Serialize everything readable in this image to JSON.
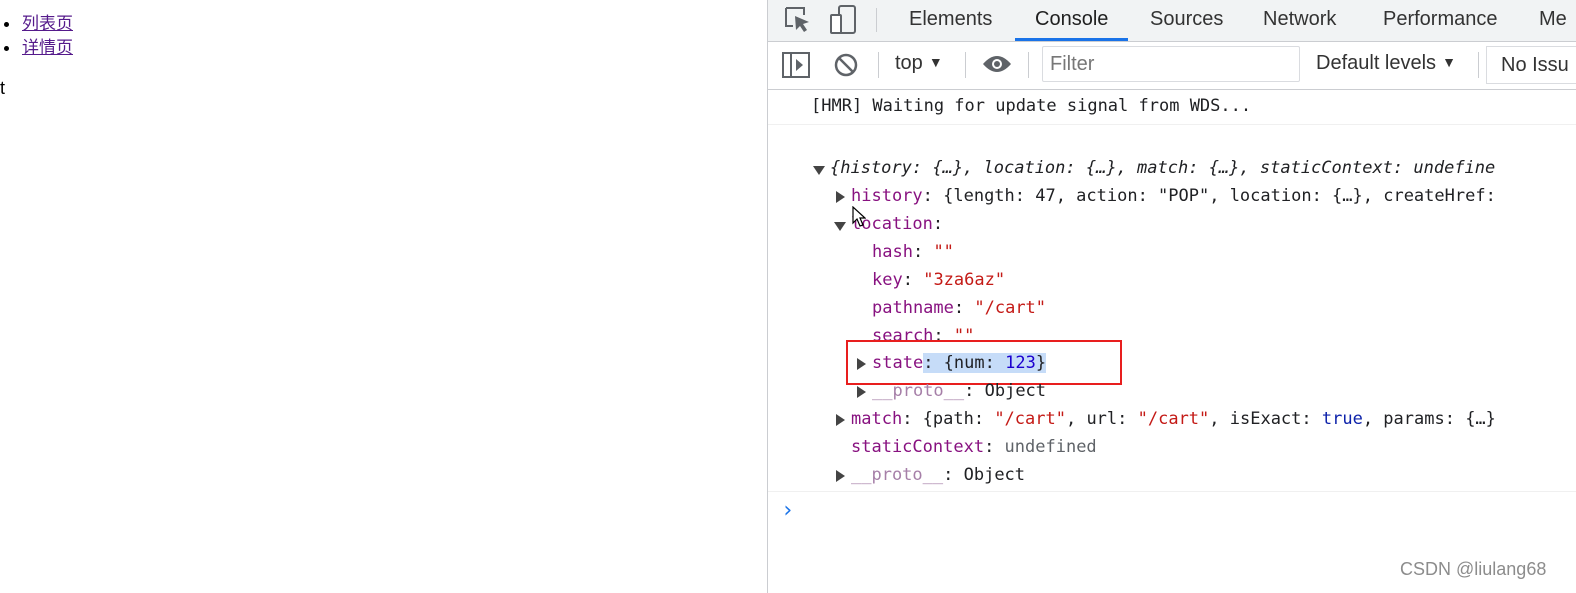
{
  "page": {
    "nav_items": [
      "列表页",
      "详情页"
    ],
    "body_text": "rt"
  },
  "devtools": {
    "tabs": [
      "Elements",
      "Console",
      "Sources",
      "Network",
      "Performance",
      "Me"
    ],
    "active_tab": "Console",
    "icons": [
      "inspect-element-icon",
      "device-toggle-icon",
      "sidebar-toggle-icon",
      "clear-console-icon",
      "eye-icon",
      "prompt-chevron-icon"
    ],
    "accent_color": "#1a73e8",
    "toolbar": {
      "context": "top",
      "filter_placeholder": "Filter",
      "levels": "Default levels",
      "issues": "No Issu"
    },
    "console": {
      "hmr_message": "[HMR] Waiting for update signal from WDS...",
      "summary": "{history: {…}, location: {…}, match: {…}, staticContext: undefine",
      "history_key": "history",
      "history_value": ": {length: 47, action: \"POP\", location: {…}, createHref:",
      "location_key": "location",
      "hash_key": "hash",
      "hash_value": "\"\"",
      "key_key": "key",
      "key_value": "\"3za6az\"",
      "pathname_key": "pathname",
      "pathname_value": "\"/cart\"",
      "search_key": "search",
      "search_value": "\"\"",
      "state_key": "state",
      "state_inner_key": "num",
      "state_inner_value": "123",
      "proto_key": "__proto__",
      "proto_value": "Object",
      "match_key": "match",
      "match_path": "\"/cart\"",
      "match_url": "\"/cart\"",
      "match_exact": "true",
      "match_params": "{…}",
      "static_key": "staticContext",
      "static_value": "undefined",
      "proto2_key": "__proto__",
      "proto2_value": "Object"
    },
    "watermark": "CSDN @liulang68"
  }
}
